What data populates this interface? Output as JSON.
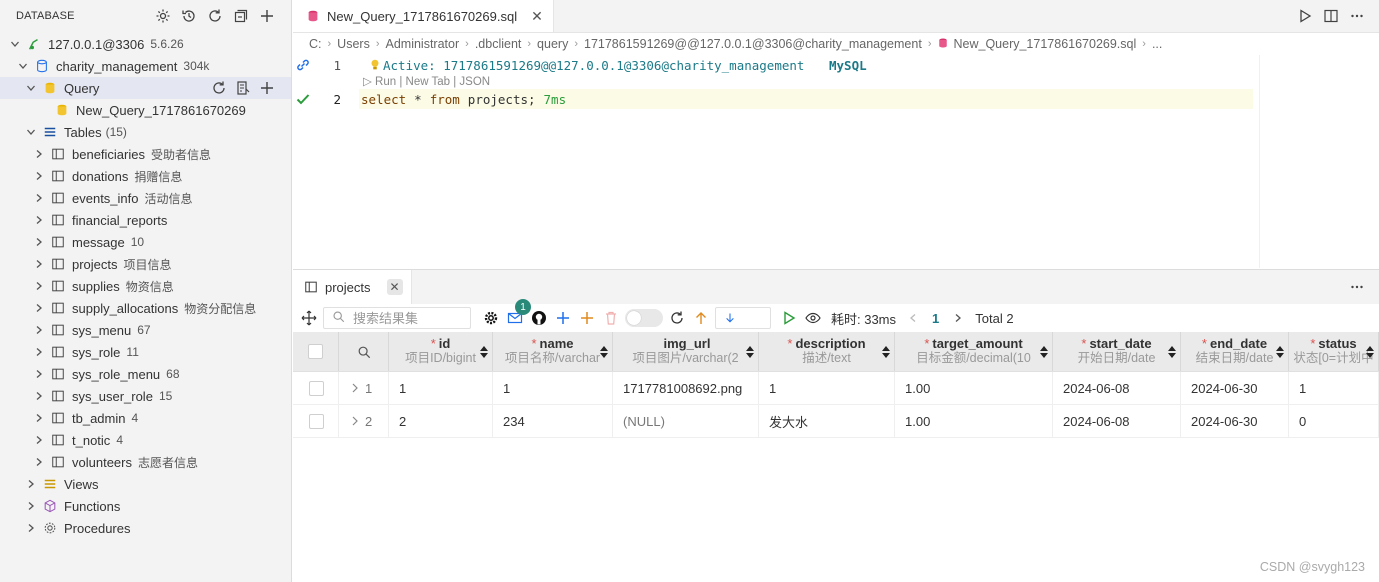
{
  "sidebar": {
    "header": "DATABASE",
    "connection": {
      "label": "127.0.0.1@3306",
      "version": "5.6.26"
    },
    "database": {
      "label": "charity_management",
      "size": "304k"
    },
    "query_folder": {
      "label": "Query"
    },
    "query_file": {
      "label": "New_Query_1717861670269"
    },
    "tables_folder": {
      "label": "Tables",
      "count": "(15)"
    },
    "tables": [
      {
        "name": "beneficiaries",
        "note": "受助者信息"
      },
      {
        "name": "donations",
        "note": "捐赠信息"
      },
      {
        "name": "events_info",
        "note": "活动信息"
      },
      {
        "name": "financial_reports",
        "note": ""
      },
      {
        "name": "message",
        "note": "10"
      },
      {
        "name": "projects",
        "note": "项目信息"
      },
      {
        "name": "supplies",
        "note": "物资信息"
      },
      {
        "name": "supply_allocations",
        "note": "物资分配信息"
      },
      {
        "name": "sys_menu",
        "note": "67"
      },
      {
        "name": "sys_role",
        "note": "11"
      },
      {
        "name": "sys_role_menu",
        "note": "68"
      },
      {
        "name": "sys_user_role",
        "note": "15"
      },
      {
        "name": "tb_admin",
        "note": "4"
      },
      {
        "name": "t_notic",
        "note": "4"
      },
      {
        "name": "volunteers",
        "note": "志愿者信息"
      }
    ],
    "views": "Views",
    "functions": "Functions",
    "procedures": "Procedures"
  },
  "editor": {
    "tab_title": "New_Query_1717861670269.sql",
    "breadcrumb": [
      "C:",
      "Users",
      "Administrator",
      ".dbclient",
      "query",
      "1717861591269@@127.0.0.1@3306@charity_management",
      "New_Query_1717861670269.sql",
      "..."
    ],
    "line1": {
      "num": "1",
      "text": "Active: 1717861591269@@127.0.0.1@3306@charity_management",
      "engine": "MySQL"
    },
    "codelens": "▷ Run | New Tab | JSON",
    "line2": {
      "num": "2",
      "kw_select": "select",
      "star": "*",
      "kw_from": "from",
      "table": "projects;",
      "time": "7ms"
    }
  },
  "results": {
    "tab_title": "projects",
    "search_placeholder": "搜索结果集",
    "mail_badge": "1",
    "elapsed": "耗时: 33ms",
    "page": "1",
    "total": "Total 2",
    "columns": [
      {
        "name": "id",
        "type": "项目ID/bigint",
        "req": "*"
      },
      {
        "name": "name",
        "type": "项目名称/varchar",
        "req": "*"
      },
      {
        "name": "img_url",
        "type": "项目图片/varchar(2",
        "req": ""
      },
      {
        "name": "description",
        "type": "描述/text",
        "req": "*"
      },
      {
        "name": "target_amount",
        "type": "目标金额/decimal(10",
        "req": "*"
      },
      {
        "name": "start_date",
        "type": "开始日期/date",
        "req": "*"
      },
      {
        "name": "end_date",
        "type": "结束日期/date",
        "req": "*"
      },
      {
        "name": "status",
        "type": "状态[0=计划中",
        "req": "*"
      }
    ],
    "rows": [
      {
        "num": "1",
        "cells": [
          "1",
          "1",
          "1717781008692.png",
          "1",
          "1.00",
          "2024-06-08",
          "2024-06-30",
          "1"
        ]
      },
      {
        "num": "2",
        "cells": [
          "2",
          "234",
          "(NULL)",
          "发大水",
          "1.00",
          "2024-06-08",
          "2024-06-30",
          "0"
        ]
      }
    ],
    "watermark": "CSDN @svygh123"
  },
  "colors": {
    "accent": "#1b7a88",
    "required": "#d9534f",
    "success": "#2a9d3a",
    "link": "#1f6feb"
  }
}
